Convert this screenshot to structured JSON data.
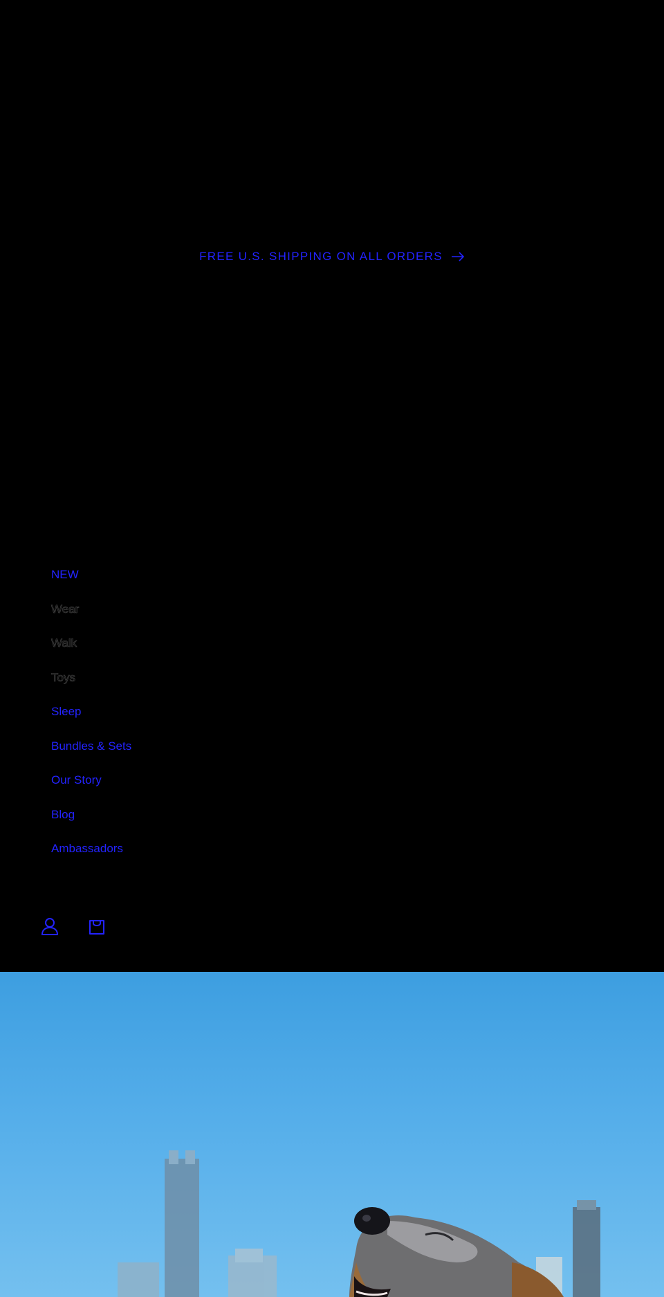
{
  "announcement": {
    "text": "FREE U.S. SHIPPING ON ALL ORDERS",
    "icon": "arrow-right-icon"
  },
  "nav": {
    "items": [
      {
        "label": "NEW",
        "dim": false
      },
      {
        "label": "Wear",
        "dim": true
      },
      {
        "label": "Walk",
        "dim": true
      },
      {
        "label": "Toys",
        "dim": true
      },
      {
        "label": "Sleep",
        "dim": false
      },
      {
        "label": "Bundles & Sets",
        "dim": false
      },
      {
        "label": "Our Story",
        "dim": false
      },
      {
        "label": "Blog",
        "dim": false
      },
      {
        "label": "Ambassadors",
        "dim": false
      }
    ]
  },
  "header_icons": {
    "account": "account-icon",
    "cart": "cart-icon"
  },
  "colors": {
    "background": "#000000",
    "link": "#2323ff",
    "sky": "#4aa8e6"
  }
}
